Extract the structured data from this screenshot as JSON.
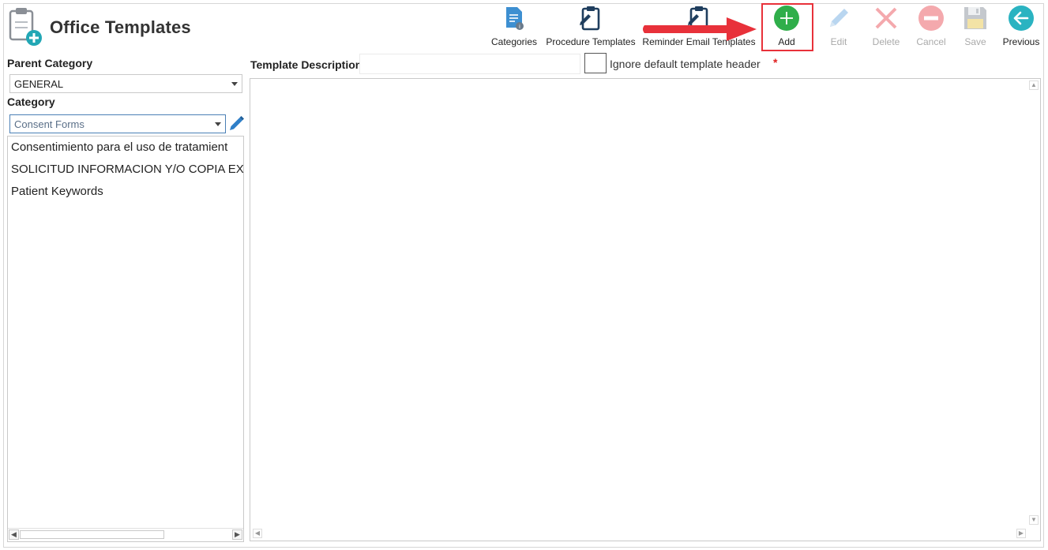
{
  "app": {
    "title": "Office Templates",
    "icon": "clipboard-plus-icon"
  },
  "toolbar": {
    "categories": {
      "label": "Categories",
      "icon": "categories-icon"
    },
    "procedure_templates": {
      "label": "Procedure Templates",
      "icon": "clipboard-icon"
    },
    "reminder_email_templates": {
      "label": "Reminder Email Templates",
      "icon": "clipboard-icon"
    },
    "add": {
      "label": "Add",
      "icon": "plus-circle-icon"
    },
    "edit": {
      "label": "Edit",
      "icon": "pencil-icon"
    },
    "delete": {
      "label": "Delete",
      "icon": "x-icon"
    },
    "cancel": {
      "label": "Cancel",
      "icon": "minus-circle-icon"
    },
    "save": {
      "label": "Save",
      "icon": "floppy-icon"
    },
    "previous": {
      "label": "Previous",
      "icon": "arrow-left-circle-icon"
    }
  },
  "left": {
    "parent_category_label": "Parent Category",
    "parent_category_value": "GENERAL",
    "category_label": "Category",
    "category_value": "Consent Forms",
    "templates": [
      "Consentimiento para el uso de tratamient",
      "SOLICITUD INFORMACION Y/O COPIA EX",
      "Patient Keywords"
    ]
  },
  "right": {
    "template_description_label": "Template Description",
    "template_description_value": "",
    "ignore_header_label": "Ignore default template header",
    "required_marker": "*"
  },
  "colors": {
    "highlight": "#e8313a",
    "add_green": "#2fae4a",
    "arrow_red": "#e8313a"
  }
}
